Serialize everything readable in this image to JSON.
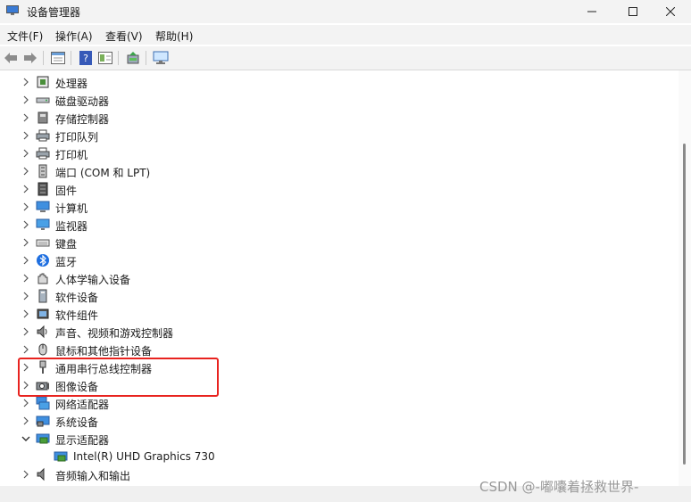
{
  "window": {
    "title": "设备管理器",
    "icons": {
      "app": "device-manager-icon",
      "minimize": "minimize-icon",
      "maximize": "maximize-icon",
      "close": "close-icon"
    }
  },
  "menu": [
    "文件(F)",
    "操作(A)",
    "查看(V)",
    "帮助(H)"
  ],
  "toolbar": [
    "back-arrow-icon",
    "forward-arrow-icon",
    "properties-icon",
    "help-icon",
    "view-icon",
    "update-driver-icon",
    "monitor-scan-icon"
  ],
  "tree": [
    {
      "label": "处理器",
      "icon": "processor-icon"
    },
    {
      "label": "磁盘驱动器",
      "icon": "disk-drive-icon"
    },
    {
      "label": "存储控制器",
      "icon": "storage-controller-icon"
    },
    {
      "label": "打印队列",
      "icon": "printer-icon"
    },
    {
      "label": "打印机",
      "icon": "printer-icon"
    },
    {
      "label": "端口 (COM 和 LPT)",
      "icon": "port-icon"
    },
    {
      "label": "固件",
      "icon": "firmware-icon"
    },
    {
      "label": "计算机",
      "icon": "computer-icon"
    },
    {
      "label": "监视器",
      "icon": "monitor-icon"
    },
    {
      "label": "键盘",
      "icon": "keyboard-icon"
    },
    {
      "label": "蓝牙",
      "icon": "bluetooth-icon"
    },
    {
      "label": "人体学输入设备",
      "icon": "hid-icon"
    },
    {
      "label": "软件设备",
      "icon": "software-device-icon"
    },
    {
      "label": "软件组件",
      "icon": "software-component-icon"
    },
    {
      "label": "声音、视频和游戏控制器",
      "icon": "speaker-icon"
    },
    {
      "label": "鼠标和其他指针设备",
      "icon": "mouse-icon"
    },
    {
      "label": "通用串行总线控制器",
      "icon": "usb-icon"
    },
    {
      "label": "图像设备",
      "icon": "camera-icon"
    },
    {
      "label": "网络适配器",
      "icon": "network-adapter-icon"
    },
    {
      "label": "系统设备",
      "icon": "system-device-icon"
    },
    {
      "label": "显示适配器",
      "icon": "display-adapter-icon",
      "expanded": true,
      "children": [
        {
          "label": "Intel(R) UHD Graphics 730",
          "icon": "display-adapter-icon"
        }
      ]
    },
    {
      "label": "音频输入和输出",
      "icon": "audio-io-icon"
    }
  ],
  "watermark": "CSDN @-嘟囔着拯救世界-",
  "colors": {
    "highlight": "#e8231f",
    "chrome": "#f3f3f3"
  }
}
